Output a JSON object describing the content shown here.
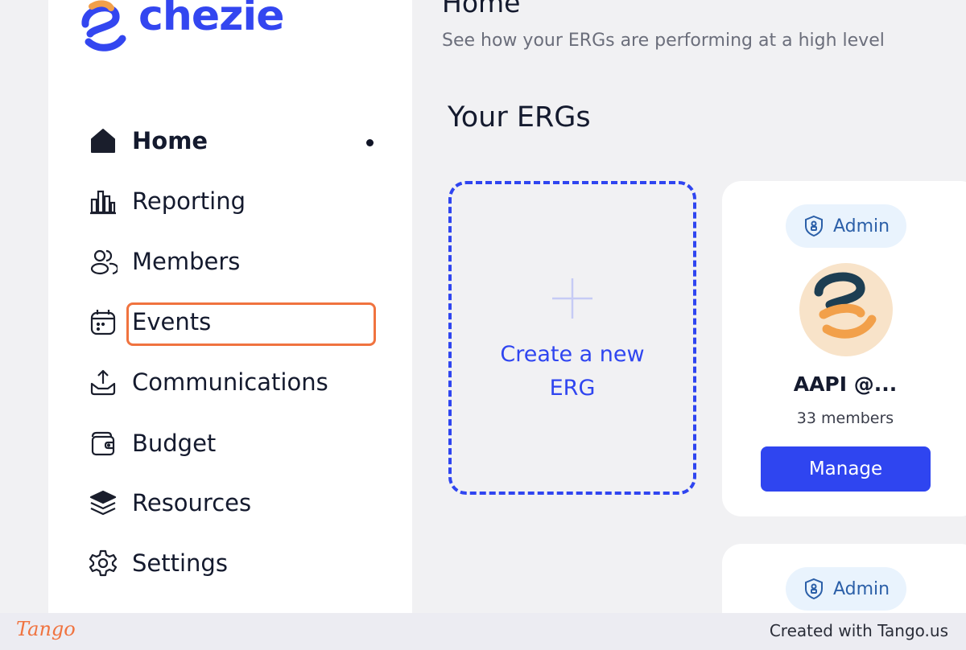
{
  "app": {
    "brand": "chezie",
    "brand_color": "#3346f0",
    "accent_orange": "#f2a04a"
  },
  "sidebar": {
    "items": [
      {
        "label": "Home",
        "icon": "home-icon",
        "active": true
      },
      {
        "label": "Reporting",
        "icon": "bar-chart-icon"
      },
      {
        "label": "Members",
        "icon": "users-icon"
      },
      {
        "label": "Events",
        "icon": "calendar-icon",
        "highlighted": true
      },
      {
        "label": "Communications",
        "icon": "upload-icon"
      },
      {
        "label": "Budget",
        "icon": "wallet-icon"
      },
      {
        "label": "Resources",
        "icon": "layers-icon"
      },
      {
        "label": "Settings",
        "icon": "gear-icon"
      }
    ]
  },
  "main": {
    "title": "Home",
    "subtitle": "See how your ERGs are performing at a high level",
    "section_title": "Your ERGs",
    "create_card": {
      "label": "Create a new ERG",
      "icon": "plus-icon"
    },
    "ergs": [
      {
        "badge": "Admin",
        "badge_icon": "shield-icon",
        "name": "AAPI @...",
        "members": "33 members",
        "action": "Manage"
      },
      {
        "badge": "Admin",
        "badge_icon": "shield-icon"
      }
    ]
  },
  "footer": {
    "logo_text": "Tango",
    "credit": "Created with Tango.us"
  }
}
